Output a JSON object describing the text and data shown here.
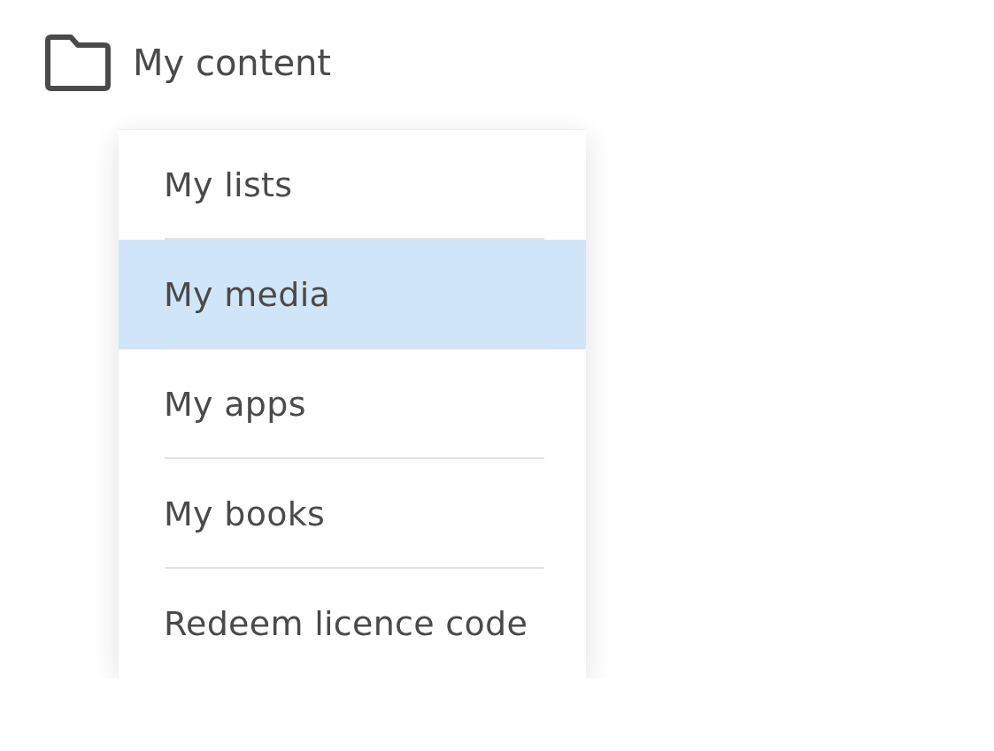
{
  "header": {
    "label": "My content"
  },
  "menu": {
    "items": [
      {
        "label": "My lists",
        "selected": false
      },
      {
        "label": "My media",
        "selected": true
      },
      {
        "label": "My apps",
        "selected": false
      },
      {
        "label": "My books",
        "selected": false
      },
      {
        "label": "Redeem licence code",
        "selected": false
      }
    ]
  }
}
